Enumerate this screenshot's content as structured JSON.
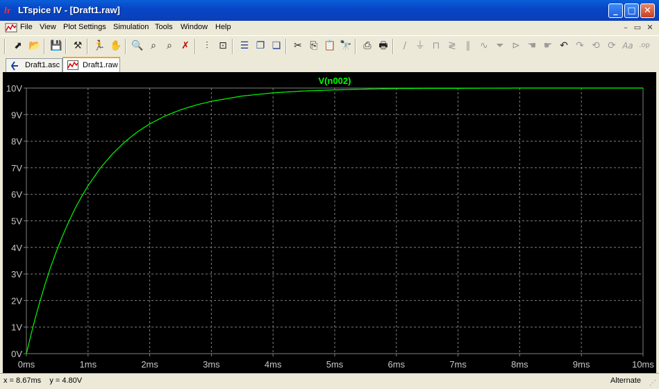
{
  "window": {
    "title": "LTspice IV - [Draft1.raw]",
    "app_icon": "ltspice-icon",
    "controls": {
      "minimize": "_",
      "maximize": "□",
      "close": "✕"
    }
  },
  "menubar": {
    "items": [
      "File",
      "View",
      "Plot Settings",
      "Simulation",
      "Tools",
      "Window",
      "Help"
    ],
    "mdi_controls": [
      "–",
      "▭",
      "✕"
    ]
  },
  "toolbar": {
    "buttons": [
      {
        "icon": "new-schematic-icon",
        "glyph": "⬈"
      },
      {
        "icon": "open-folder-icon",
        "glyph": "📂"
      },
      {
        "icon": "save-icon",
        "glyph": "💾"
      },
      {
        "icon": "control-panel-hammer-icon",
        "glyph": "⚒"
      },
      {
        "icon": "run-simulation-icon",
        "glyph": "🏃"
      },
      {
        "icon": "halt-hand-icon",
        "glyph": "✋"
      },
      {
        "icon": "zoom-in-icon",
        "glyph": "🔍"
      },
      {
        "icon": "zoom-pan-icon",
        "glyph": "⌕"
      },
      {
        "icon": "zoom-out-icon",
        "glyph": "⌕"
      },
      {
        "icon": "zoom-fit-icon",
        "glyph": "✗"
      },
      {
        "icon": "autorange-icon",
        "glyph": "⫶"
      },
      {
        "icon": "measure-icon",
        "glyph": "⊡"
      },
      {
        "icon": "tile-horizontal-icon",
        "glyph": "☰"
      },
      {
        "icon": "cascade-icon",
        "glyph": "❐"
      },
      {
        "icon": "tile-vertical-icon",
        "glyph": "❏"
      },
      {
        "icon": "cut-icon",
        "glyph": "✂"
      },
      {
        "icon": "copy-icon",
        "glyph": "⎘"
      },
      {
        "icon": "paste-icon",
        "glyph": "📋"
      },
      {
        "icon": "find-binoculars-icon",
        "glyph": "🔭"
      },
      {
        "icon": "print-setup-icon",
        "glyph": "⎙"
      },
      {
        "icon": "print-icon",
        "glyph": "🖶"
      },
      {
        "icon": "draw-wire-icon",
        "glyph": "∕"
      },
      {
        "icon": "ground-icon",
        "glyph": "⏚"
      },
      {
        "icon": "label-net-icon",
        "glyph": "⊓"
      },
      {
        "icon": "resistor-icon",
        "glyph": "≷"
      },
      {
        "icon": "capacitor-icon",
        "glyph": "∥"
      },
      {
        "icon": "inductor-icon",
        "glyph": "∿"
      },
      {
        "icon": "diode-icon",
        "glyph": "⏷"
      },
      {
        "icon": "component-icon",
        "glyph": "⊳"
      },
      {
        "icon": "move-hand-icon",
        "glyph": "☚"
      },
      {
        "icon": "drag-hand-icon",
        "glyph": "☛"
      },
      {
        "icon": "undo-icon",
        "glyph": "↶"
      },
      {
        "icon": "redo-icon",
        "glyph": "↷"
      },
      {
        "icon": "rotate-icon",
        "glyph": "⟲"
      },
      {
        "icon": "mirror-icon",
        "glyph": "⟳"
      },
      {
        "icon": "text-icon",
        "glyph": "Aa"
      },
      {
        "icon": "spice-directive-icon",
        "glyph": ".op"
      }
    ]
  },
  "tabs": [
    {
      "label": "Draft1.asc",
      "icon": "schematic-icon",
      "active": false
    },
    {
      "label": "Draft1.raw",
      "icon": "waveform-icon",
      "active": true
    }
  ],
  "plot": {
    "background": "#000000",
    "trace_color": "#00FF00",
    "grid_color": "#808080",
    "axis_color": "#808080"
  },
  "chart_data": {
    "type": "line",
    "title": "V(n002)",
    "xlabel": "",
    "ylabel": "",
    "xlim": [
      0,
      10
    ],
    "ylim": [
      0,
      10
    ],
    "x_ticks": [
      "0ms",
      "1ms",
      "2ms",
      "3ms",
      "4ms",
      "5ms",
      "6ms",
      "7ms",
      "8ms",
      "9ms",
      "10ms"
    ],
    "y_ticks": [
      "0V",
      "1V",
      "2V",
      "3V",
      "4V",
      "5V",
      "6V",
      "7V",
      "8V",
      "9V",
      "10V"
    ],
    "grid": true,
    "series": [
      {
        "name": "V(n002)",
        "x": [
          0,
          0.1,
          0.2,
          0.3,
          0.4,
          0.5,
          0.6,
          0.7,
          0.8,
          0.9,
          1.0,
          1.2,
          1.4,
          1.6,
          1.8,
          2.0,
          2.25,
          2.5,
          2.75,
          3.0,
          3.5,
          4.0,
          4.5,
          5.0,
          5.5,
          6.0,
          6.5,
          7.0,
          8.0,
          9.0,
          10.0
        ],
        "y": [
          0,
          0.95,
          1.81,
          2.59,
          3.3,
          3.93,
          4.51,
          5.03,
          5.51,
          5.93,
          6.32,
          6.99,
          7.53,
          7.98,
          8.35,
          8.65,
          8.95,
          9.18,
          9.36,
          9.5,
          9.7,
          9.82,
          9.89,
          9.93,
          9.96,
          9.98,
          9.99,
          9.99,
          10.0,
          10.0,
          10.0
        ]
      }
    ]
  },
  "status": {
    "cursor": "x = 8.67ms    y = 4.80V",
    "mode": "Alternate"
  }
}
